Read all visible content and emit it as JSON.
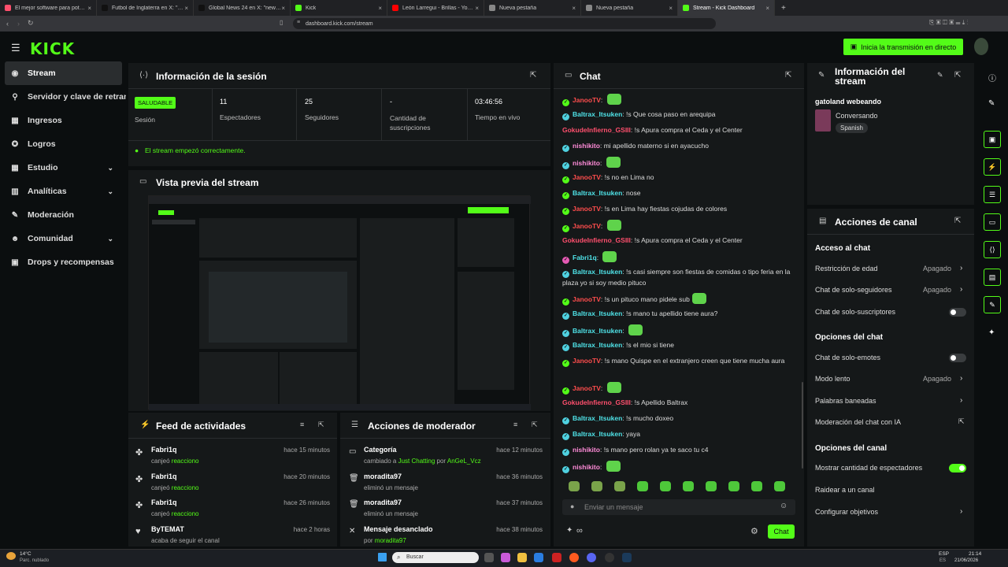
{
  "browser": {
    "tabs": [
      {
        "title": "El mejor software para potenciar tu c...",
        "color": "#ff4f6d"
      },
      {
        "title": "Futbol de Inglaterra en X: \"Al...",
        "color": "#111111"
      },
      {
        "title": "Global News 24 en X: \"new Prostitut...",
        "color": "#111111"
      },
      {
        "title": "Kick",
        "color": "#53fc18"
      },
      {
        "title": "León Larregui - Brillas - YouTube",
        "color": "#ff0000"
      },
      {
        "title": "Nueva pestaña",
        "color": "#888888"
      },
      {
        "title": "Nueva pestaña",
        "color": "#888888"
      },
      {
        "title": "Stream - Kick Dashboard",
        "color": "#53fc18",
        "active": true
      }
    ],
    "url": "dashboard.kick.com/stream"
  },
  "header": {
    "logo": "KICK",
    "go_live": "Inicia la transmisión en directo"
  },
  "sidebar": {
    "items": [
      {
        "label": "Stream",
        "icon": "home-icon",
        "active": true
      },
      {
        "label": "Servidor y clave de retran",
        "icon": "link-icon"
      },
      {
        "label": "Ingresos",
        "icon": "cash-icon"
      },
      {
        "label": "Logros",
        "icon": "trophy-icon"
      },
      {
        "label": "Estudio",
        "icon": "grid-icon",
        "chevron": true
      },
      {
        "label": "Analíticas",
        "icon": "chart-icon",
        "chevron": true
      },
      {
        "label": "Moderación",
        "icon": "wrench-icon"
      },
      {
        "label": "Comunidad",
        "icon": "people-icon",
        "chevron": true
      },
      {
        "label": "Drops y recompensas",
        "icon": "gift-icon"
      }
    ]
  },
  "session": {
    "title": "Información de la sesión",
    "status": "SALUDABLE",
    "status_label": "Sesión",
    "viewers": "11",
    "viewers_label": "Espectadores",
    "followers": "25",
    "followers_label": "Seguidores",
    "subs": "-",
    "subs_label": "Cantidad de suscripciones",
    "time": "03:46:56",
    "time_label": "Tiempo en vivo",
    "ok_message": "El stream empezó correctamente."
  },
  "preview": {
    "title": "Vista previa del stream"
  },
  "feed": {
    "title": "Feed de actividades",
    "items": [
      {
        "name": "Fabri1q",
        "action": "canjeó ",
        "highlight": "reacciono",
        "time": "hace 15 minutos"
      },
      {
        "name": "Fabri1q",
        "action": "canjeó ",
        "highlight": "reacciono",
        "time": "hace 20 minutos"
      },
      {
        "name": "Fabri1q",
        "action": "canjeó ",
        "highlight": "reacciono",
        "time": "hace 26 minutos"
      },
      {
        "name": "ByTEMAT",
        "action": "acaba de seguir el canal",
        "highlight": "",
        "time": "hace 2 horas"
      }
    ]
  },
  "modactions": {
    "title": "Acciones de moderador",
    "items": [
      {
        "name": "Categoría",
        "line": "cambiado a ",
        "hl1": "Just Chatting",
        "mid": " por ",
        "hl2": "AnGeL_Vcz",
        "time": "hace 12 minutos"
      },
      {
        "name": "moradita97",
        "line": "eliminó un mensaje",
        "hl1": "",
        "mid": "",
        "hl2": "",
        "time": "hace 36 minutos"
      },
      {
        "name": "moradita97",
        "line": "eliminó un mensaje",
        "hl1": "",
        "mid": "",
        "hl2": "",
        "time": "hace 37 minutos"
      },
      {
        "name": "Mensaje desanclado",
        "line": "por ",
        "hl1": "moradita97",
        "mid": "",
        "hl2": "",
        "time": "hace 38 minutos"
      }
    ]
  },
  "chat": {
    "title": "Chat",
    "messages": [
      {
        "user": "JanooTV",
        "cls": "red",
        "badge": "bv",
        "text": "",
        "emote": true
      },
      {
        "user": "Baltrax_Itsuken",
        "cls": "cy",
        "badge": "bs",
        "text": "!s Que cosa paso en arequipa"
      },
      {
        "user": "GokudeInfierno_GSIII",
        "cls": "rd2",
        "badge": "",
        "text": "!s Apura compra el Ceda y el Center"
      },
      {
        "user": "nishikito",
        "cls": "pk",
        "badge": "bs",
        "text": "mi apellido materno si en ayacucho"
      },
      {
        "user": "nishikito",
        "cls": "pk",
        "badge": "bs",
        "text": "",
        "emote": true
      },
      {
        "user": "JanooTV",
        "cls": "red",
        "badge": "bv",
        "text": "!s no en Lima no"
      },
      {
        "user": "Baltrax_Itsuken",
        "cls": "cy",
        "badge": "bv",
        "text": "nose"
      },
      {
        "user": "JanooTV",
        "cls": "red",
        "badge": "bv",
        "text": "!s en Lima hay fiestas cojudas de colores"
      },
      {
        "user": "JanooTV",
        "cls": "red",
        "badge": "bv",
        "text": "",
        "emote": true
      },
      {
        "user": "GokudeInfierno_GSIII",
        "cls": "rd2",
        "badge": "",
        "text": "!s Apura compra el Ceda y el Center"
      },
      {
        "user": "Fabri1q",
        "cls": "cy",
        "badge": "bp",
        "text": "",
        "emote": true
      },
      {
        "user": "Baltrax_Itsuken",
        "cls": "cy",
        "badge": "bs",
        "text": "!s casi siempre son fiestas de comidas o tipo feria en la plaza yo si soy medio pituco",
        "tall": true
      },
      {
        "user": "JanooTV",
        "cls": "red",
        "badge": "bv",
        "text": "!s un pituco mano pidele sub",
        "emote": true
      },
      {
        "user": "Baltrax_Itsuken",
        "cls": "cy",
        "badge": "bs",
        "text": "!s mano tu apellido tiene aura?"
      },
      {
        "user": "Baltrax_Itsuken",
        "cls": "cy",
        "badge": "bs",
        "text": "",
        "emote": true
      },
      {
        "user": "Baltrax_Itsuken",
        "cls": "cy",
        "badge": "bs",
        "text": "!s el mio si tiene"
      },
      {
        "user": "JanooTV",
        "cls": "red",
        "badge": "bv",
        "text": "!s mano Quispe en el extranjero creen que tiene mucha aura",
        "tall": true
      },
      {
        "user": "JanooTV",
        "cls": "red",
        "badge": "bv",
        "text": "",
        "emote": true
      },
      {
        "user": "GokudeInfierno_GSIII",
        "cls": "rd2",
        "badge": "",
        "text": "!s Apellido Baltrax"
      },
      {
        "user": "Baltrax_Itsuken",
        "cls": "cy",
        "badge": "bs",
        "text": "!s mucho doxeo"
      },
      {
        "user": "Baltrax_Itsuken",
        "cls": "cy",
        "badge": "bs",
        "text": "yaya"
      },
      {
        "user": "nishikito",
        "cls": "pk",
        "badge": "bs",
        "text": "!s mano pero rolan ya te saco tu c4"
      },
      {
        "user": "nishikito",
        "cls": "pk",
        "badge": "bs",
        "text": "",
        "emote": true
      }
    ],
    "input_placeholder": "Enviar un mensaje",
    "send": "Chat",
    "infinity": "∞"
  },
  "streaminfo": {
    "title": "Información del stream",
    "channel": "gatoland webeando",
    "category": "Conversando",
    "language": "Spanish"
  },
  "channelactions": {
    "title": "Acciones de canal",
    "sections": [
      {
        "heading": "Acceso al chat"
      },
      {
        "heading": "Opciones del chat"
      },
      {
        "heading": "Opciones del canal"
      }
    ],
    "rows": [
      {
        "label": "Restricción de edad",
        "value": "Apagado",
        "kind": "chev"
      },
      {
        "label": "Chat de solo-seguidores",
        "value": "Apagado",
        "kind": "chev"
      },
      {
        "label": "Chat de solo-suscriptores",
        "value": "",
        "kind": "toggle-off"
      },
      {
        "label": "Chat de solo-emotes",
        "value": "",
        "kind": "toggle-off"
      },
      {
        "label": "Modo lento",
        "value": "Apagado",
        "kind": "chev"
      },
      {
        "label": "Palabras baneadas",
        "value": "",
        "kind": "chev"
      },
      {
        "label": "Moderación del chat con IA",
        "value": "",
        "kind": "ext"
      },
      {
        "label": "Mostrar cantidad de espectadores",
        "value": "",
        "kind": "toggle-on"
      },
      {
        "label": "Raidear a un canal",
        "value": "",
        "kind": "none"
      },
      {
        "label": "Configurar objetivos",
        "value": "",
        "kind": "chev"
      }
    ]
  },
  "taskbar": {
    "weather_temp": "14°C",
    "weather_desc": "Parc. nublado",
    "search": "Buscar",
    "lang": "ESP",
    "lang2": "ES",
    "time": "21:14",
    "date": "21/06/2026"
  },
  "colors": {
    "accent": "#53fc18",
    "panel": "#151819",
    "bg": "#0b0e0f"
  }
}
